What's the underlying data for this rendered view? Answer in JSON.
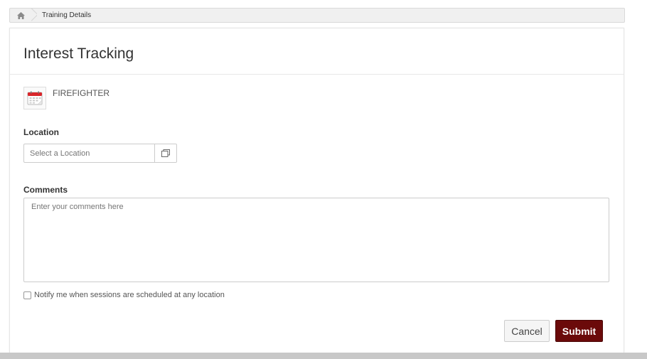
{
  "breadcrumb": {
    "home_icon": "home-icon",
    "current": "Training Details"
  },
  "page": {
    "title": "Interest Tracking"
  },
  "course": {
    "icon": "calendar-icon",
    "name": "FIREFIGHTER"
  },
  "location": {
    "label": "Location",
    "placeholder": "Select a Location",
    "value": "",
    "picker_icon": "window-icon"
  },
  "comments": {
    "label": "Comments",
    "placeholder": "Enter your comments here",
    "value": ""
  },
  "notify": {
    "checked": false,
    "label": "Notify me when sessions are scheduled at any location"
  },
  "actions": {
    "cancel_label": "Cancel",
    "submit_label": "Submit"
  },
  "colors": {
    "submit_bg": "#6b0a0a",
    "calendar_red": "#d9262b"
  }
}
